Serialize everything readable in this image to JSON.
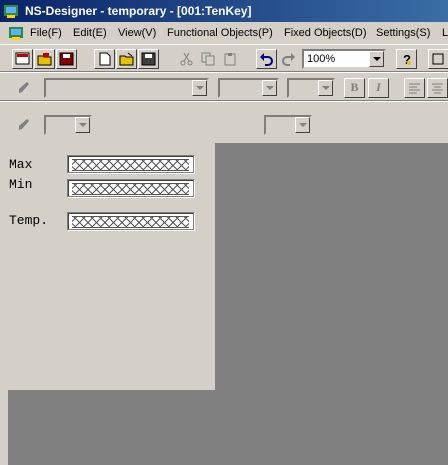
{
  "window": {
    "title": "NS-Designer - temporary - [001:TenKey]"
  },
  "menu": {
    "items": [
      "File(F)",
      "Edit(E)",
      "View(V)",
      "Functional Objects(P)",
      "Fixed Objects(D)",
      "Settings(S)",
      "L"
    ]
  },
  "toolbar1": {
    "zoom": "100%"
  },
  "toolbar2": {
    "bold_label": "B",
    "italic_label": "I"
  },
  "screen": {
    "labels": [
      "Max",
      "Min",
      "Temp."
    ]
  },
  "colors": {
    "titlebar_start": "#0a246a",
    "titlebar_end": "#3a6ea5",
    "face": "#d4d0c8",
    "workspace": "#808080"
  }
}
